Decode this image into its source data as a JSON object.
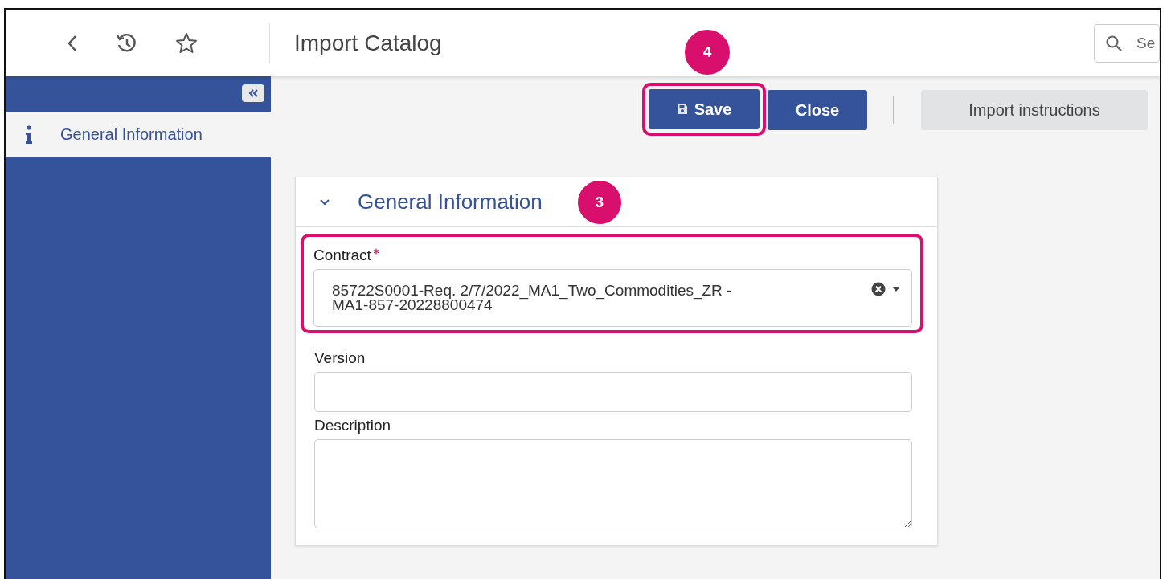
{
  "header": {
    "title": "Import Catalog",
    "search_placeholder": "Se"
  },
  "sidebar": {
    "items": [
      {
        "label": "General Information",
        "selected": true
      }
    ]
  },
  "toolbar": {
    "buttons": [
      {
        "label": "Save",
        "kind": "save",
        "highlighted": true,
        "callout": "4"
      },
      {
        "label": "Close",
        "kind": "close",
        "highlighted": false
      },
      {
        "label": "Import instructions",
        "kind": "import",
        "highlighted": false
      }
    ]
  },
  "section": {
    "title": "General Information",
    "expanded": true,
    "callout": "3",
    "fields": [
      {
        "label": "Contract",
        "required": true,
        "kind": "select",
        "value": "85722S0001-Req. 2/7/2022_MA1_Two_Commodities_ZR - MA1-857-20228800474",
        "highlighted": true
      },
      {
        "label": "Version",
        "required": false,
        "kind": "text",
        "highlighted": false
      },
      {
        "label": "Description",
        "required": false,
        "kind": "textarea",
        "highlighted": false
      }
    ]
  }
}
